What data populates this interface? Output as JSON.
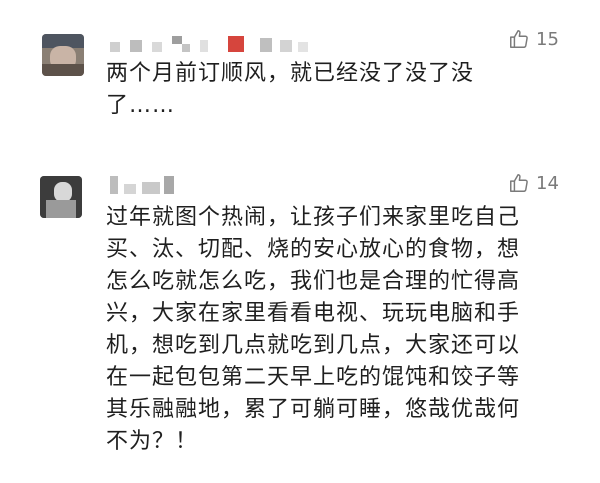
{
  "comments": [
    {
      "likes": "15",
      "lines": [
        "两个月前订顺风，就已经没了没了没",
        "了……"
      ]
    },
    {
      "likes": "14",
      "lines": [
        "过年就图个热闹，让孩子们来家里吃自己",
        "买、汰、切配、烧的安心放心的食物，想",
        "怎么吃就怎么吃，我们也是合理的忙得高",
        "兴，大家在家里看看电视、玩玩电脑和手",
        "机，想吃到几点就吃到几点，大家还可以",
        "在一起包包第二天早上吃的馄饨和饺子等",
        "其乐融融地，累了可躺可睡，悠哉优哉何",
        "不为？！"
      ]
    }
  ],
  "icons": {
    "like": "thumbs-up-icon"
  },
  "colors": {
    "meta": "#7a7a7a",
    "text": "#1f1f1f"
  }
}
